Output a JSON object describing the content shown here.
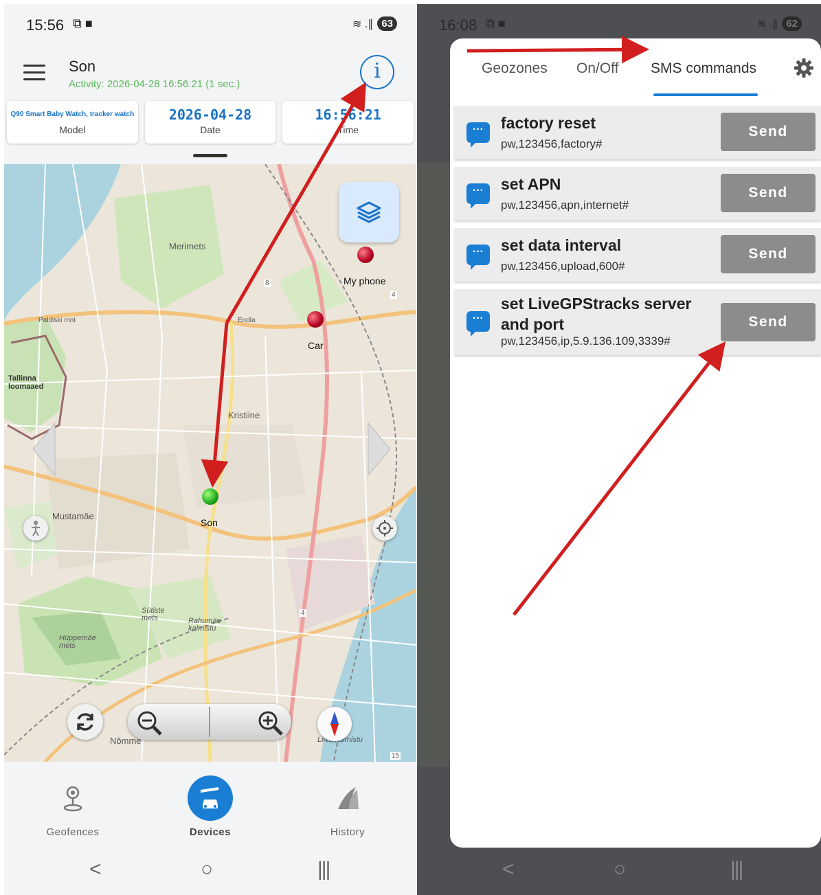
{
  "left": {
    "status": {
      "time": "15:56",
      "icons": "⧉ ■",
      "signal": "≋ .∥",
      "battery": "63"
    },
    "app": {
      "title": "Son",
      "activity": "Activity: 2026-04-28 16:56:21 (1 sec.)"
    },
    "cards": [
      {
        "value": "Q90 Smart Baby Watch, tracker watch",
        "label": "Model"
      },
      {
        "value": "2026-04-28",
        "label": "Date"
      },
      {
        "value": "16:56:21",
        "label": "Time"
      }
    ],
    "map": {
      "labels": {
        "meriimetsa": "Merimets",
        "tallinna": "Tallinna loomaaed",
        "kristiine": "Kristiine",
        "mustamae": "Mustamäe",
        "sutiste": "Sütiste mets",
        "rahumae": "Rahumäe kalmistu",
        "hippomae": "Hüppemäe mets",
        "nomme": "Nõmme",
        "liiva": "Liiva kalmistu",
        "endla": "Endla",
        "paldiski": "Paldiski mnt",
        "num15": "15",
        "num4a": "4",
        "num4b": "4",
        "num8": "8"
      },
      "pins": {
        "my_phone": "My phone",
        "car": "Car",
        "son": "Son"
      }
    },
    "nav": {
      "geofences": "Geofences",
      "devices": "Devices",
      "history": "History"
    },
    "sysnav": {
      "back": "<",
      "home": "○",
      "recents": "|||"
    }
  },
  "right": {
    "status": {
      "time": "16:08",
      "icons": "⧉ ■",
      "signal": "≋ .∥",
      "battery": "62"
    },
    "tabs": {
      "geozones": "Geozones",
      "onoff": "On/Off",
      "sms": "SMS commands"
    },
    "commands": [
      {
        "title": "factory reset",
        "code": "pw,123456,factory#",
        "button": "Send"
      },
      {
        "title": "set APN",
        "code": "pw,123456,apn,internet#",
        "button": "Send"
      },
      {
        "title": "set data interval",
        "code": "pw,123456,upload,600#",
        "button": "Send"
      },
      {
        "title": "set LiveGPStracks server and port",
        "code": "pw,123456,ip,5.9.136.109,3339#",
        "button": "Send"
      }
    ],
    "sysnav": {
      "back": "<",
      "home": "○",
      "recents": "|||"
    }
  },
  "colors": {
    "accent": "#1a7fd4",
    "activity": "#5cb85c",
    "arrow": "#d11f1f",
    "send": "#8c8c8c"
  }
}
